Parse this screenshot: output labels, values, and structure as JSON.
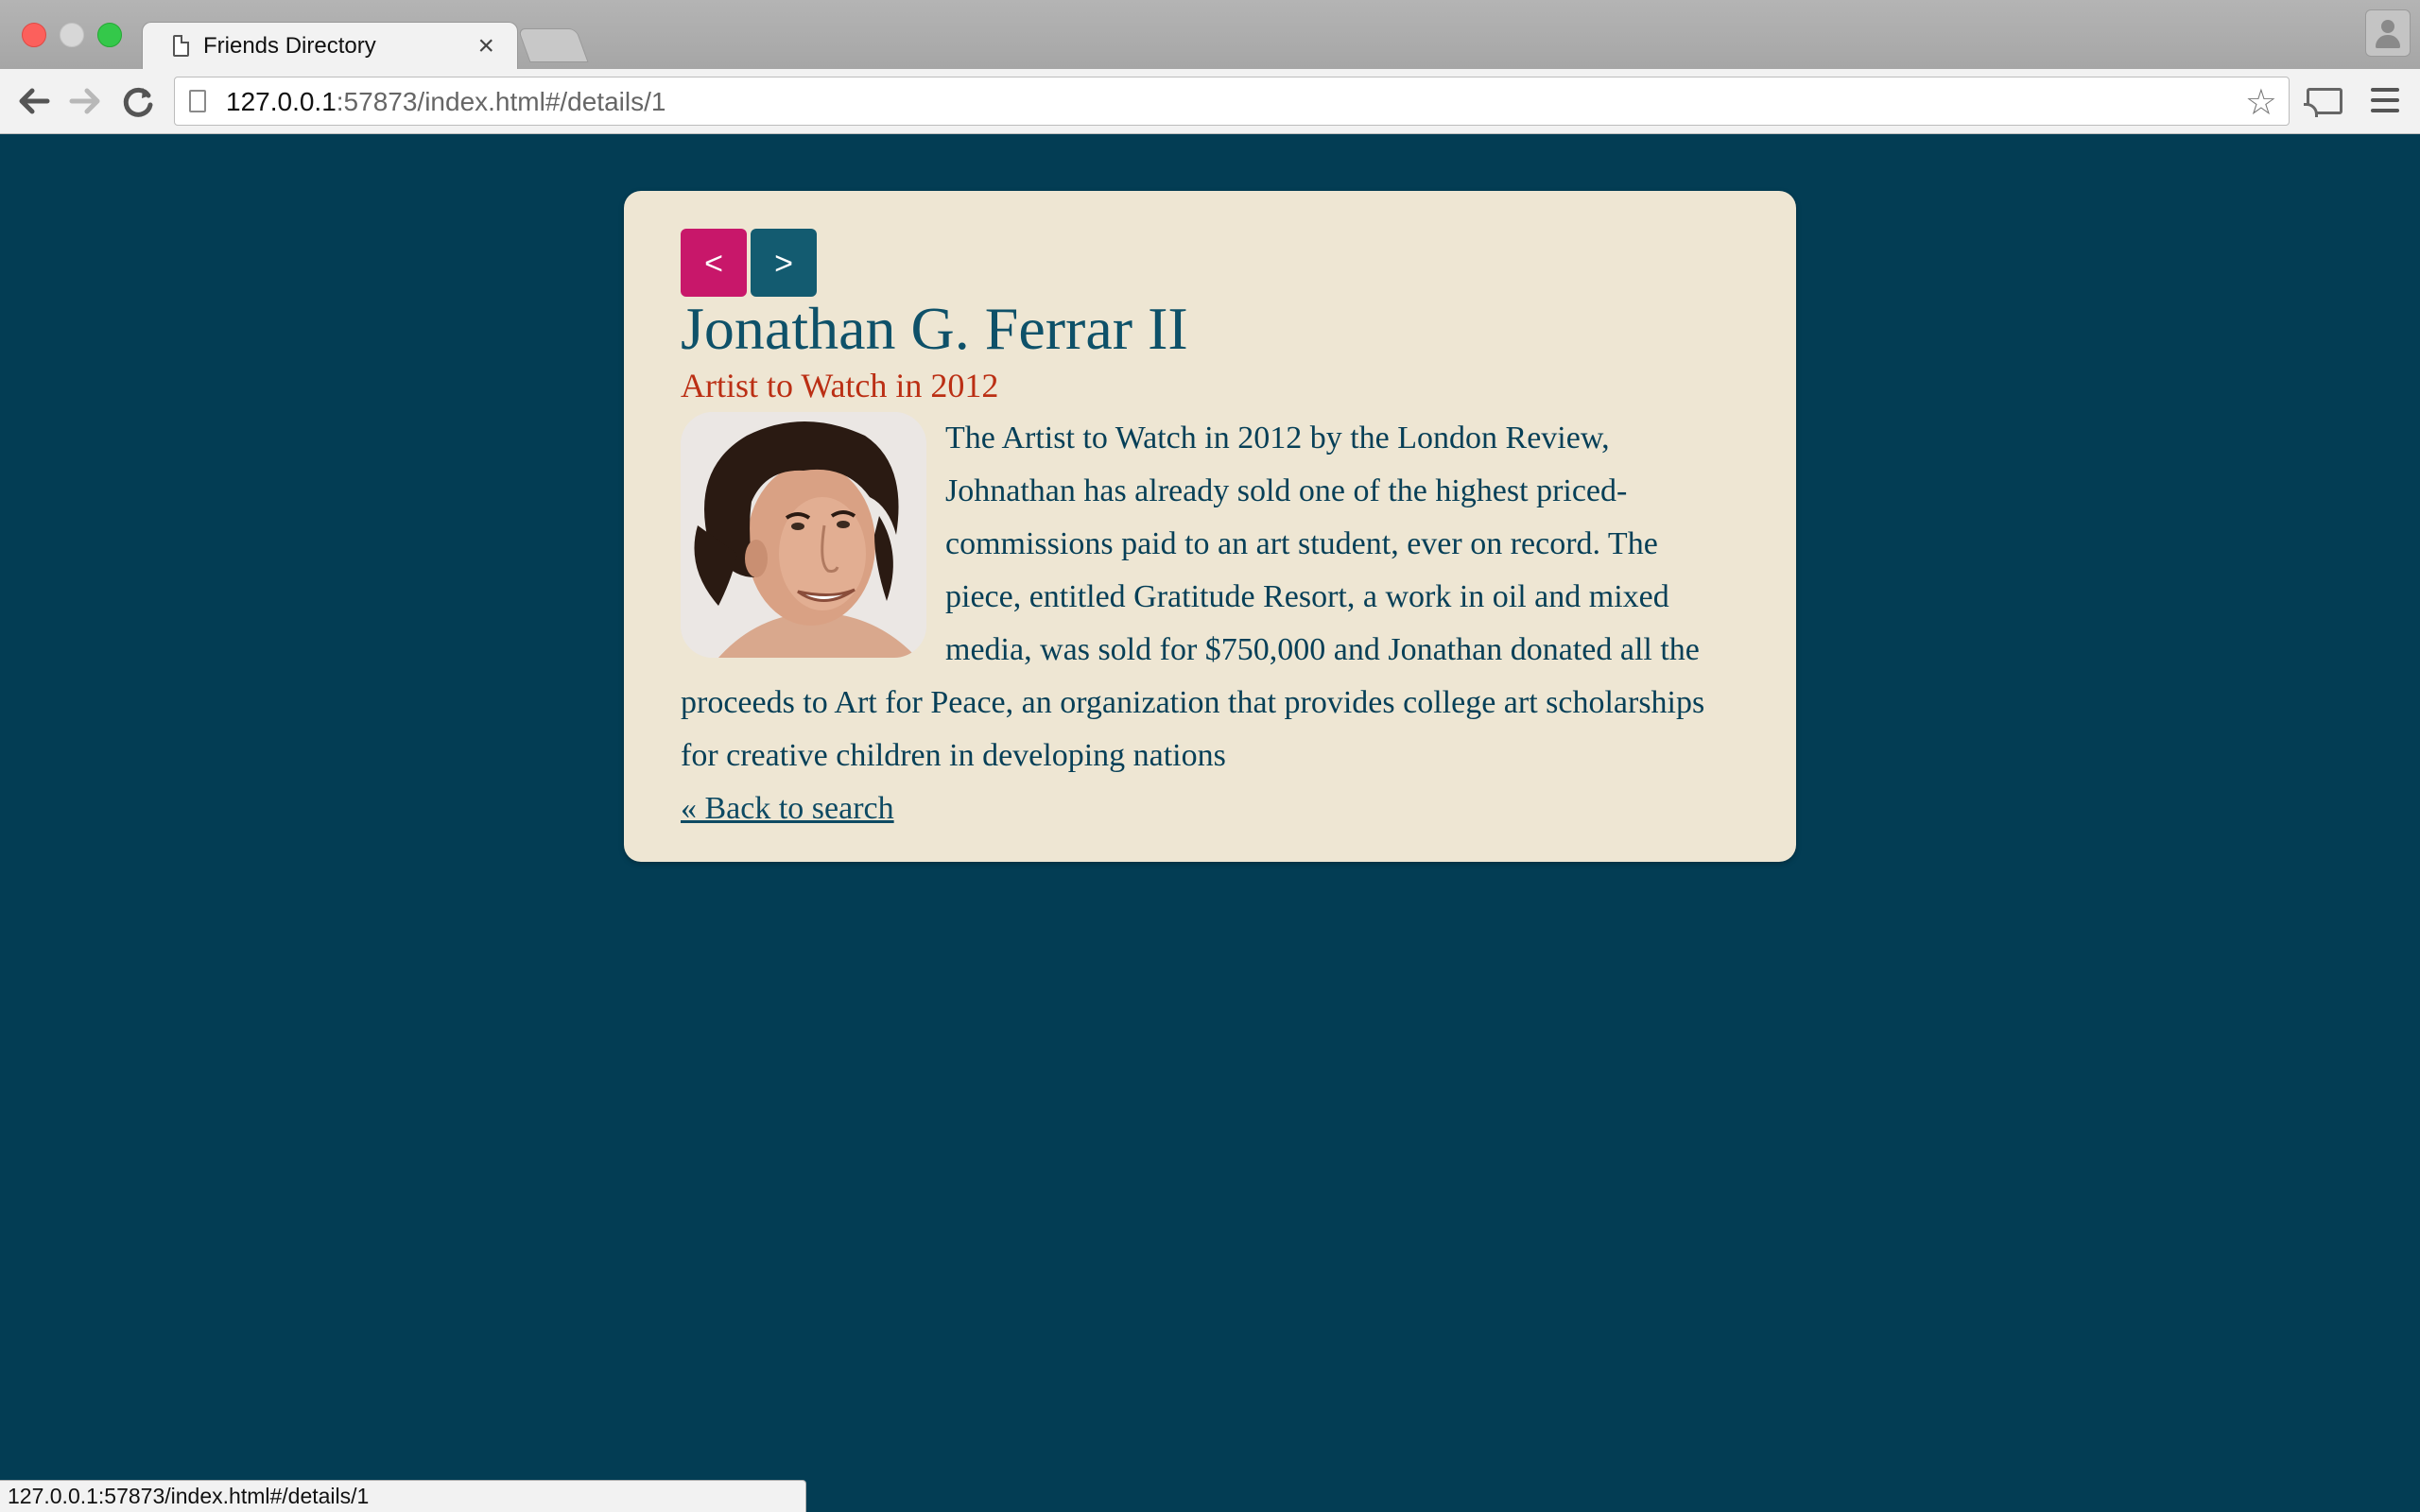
{
  "browser": {
    "tab_title": "Friends Directory",
    "tab_close": "×",
    "url_host": "127.0.0.1",
    "url_rest": ":57873/index.html#/details/1",
    "status_url": "127.0.0.1:57873/index.html#/details/1"
  },
  "icons": {
    "back": "arrow-left-icon",
    "forward": "arrow-right-icon",
    "reload": "reload-icon",
    "bookmark": "star-icon",
    "cast": "cast-icon",
    "menu": "hamburger-menu-icon",
    "profile": "profile-icon"
  },
  "pager": {
    "prev_label": "<",
    "next_label": ">"
  },
  "person": {
    "name": "Jonathan G. Ferrar II",
    "title": "Artist to Watch in 2012",
    "bio": "The Artist to Watch in 2012 by the London Review, Johnathan has already sold one of the highest priced-commissions paid to an art student, ever on record. The piece, entitled Gratitude Resort, a work in oil and mixed media, was sold for $750,000 and Jonathan donated all the proceeds to Art for Peace, an organization that provides college art scholarships for creative children in developing nations"
  },
  "back_link": "« Back to search",
  "colors": {
    "page_bg": "#033d54",
    "card_bg": "#eee6d3",
    "name": "#0e5169",
    "subtitle": "#bb2f14",
    "prev_button": "#c8176a",
    "next_button": "#135b70"
  }
}
